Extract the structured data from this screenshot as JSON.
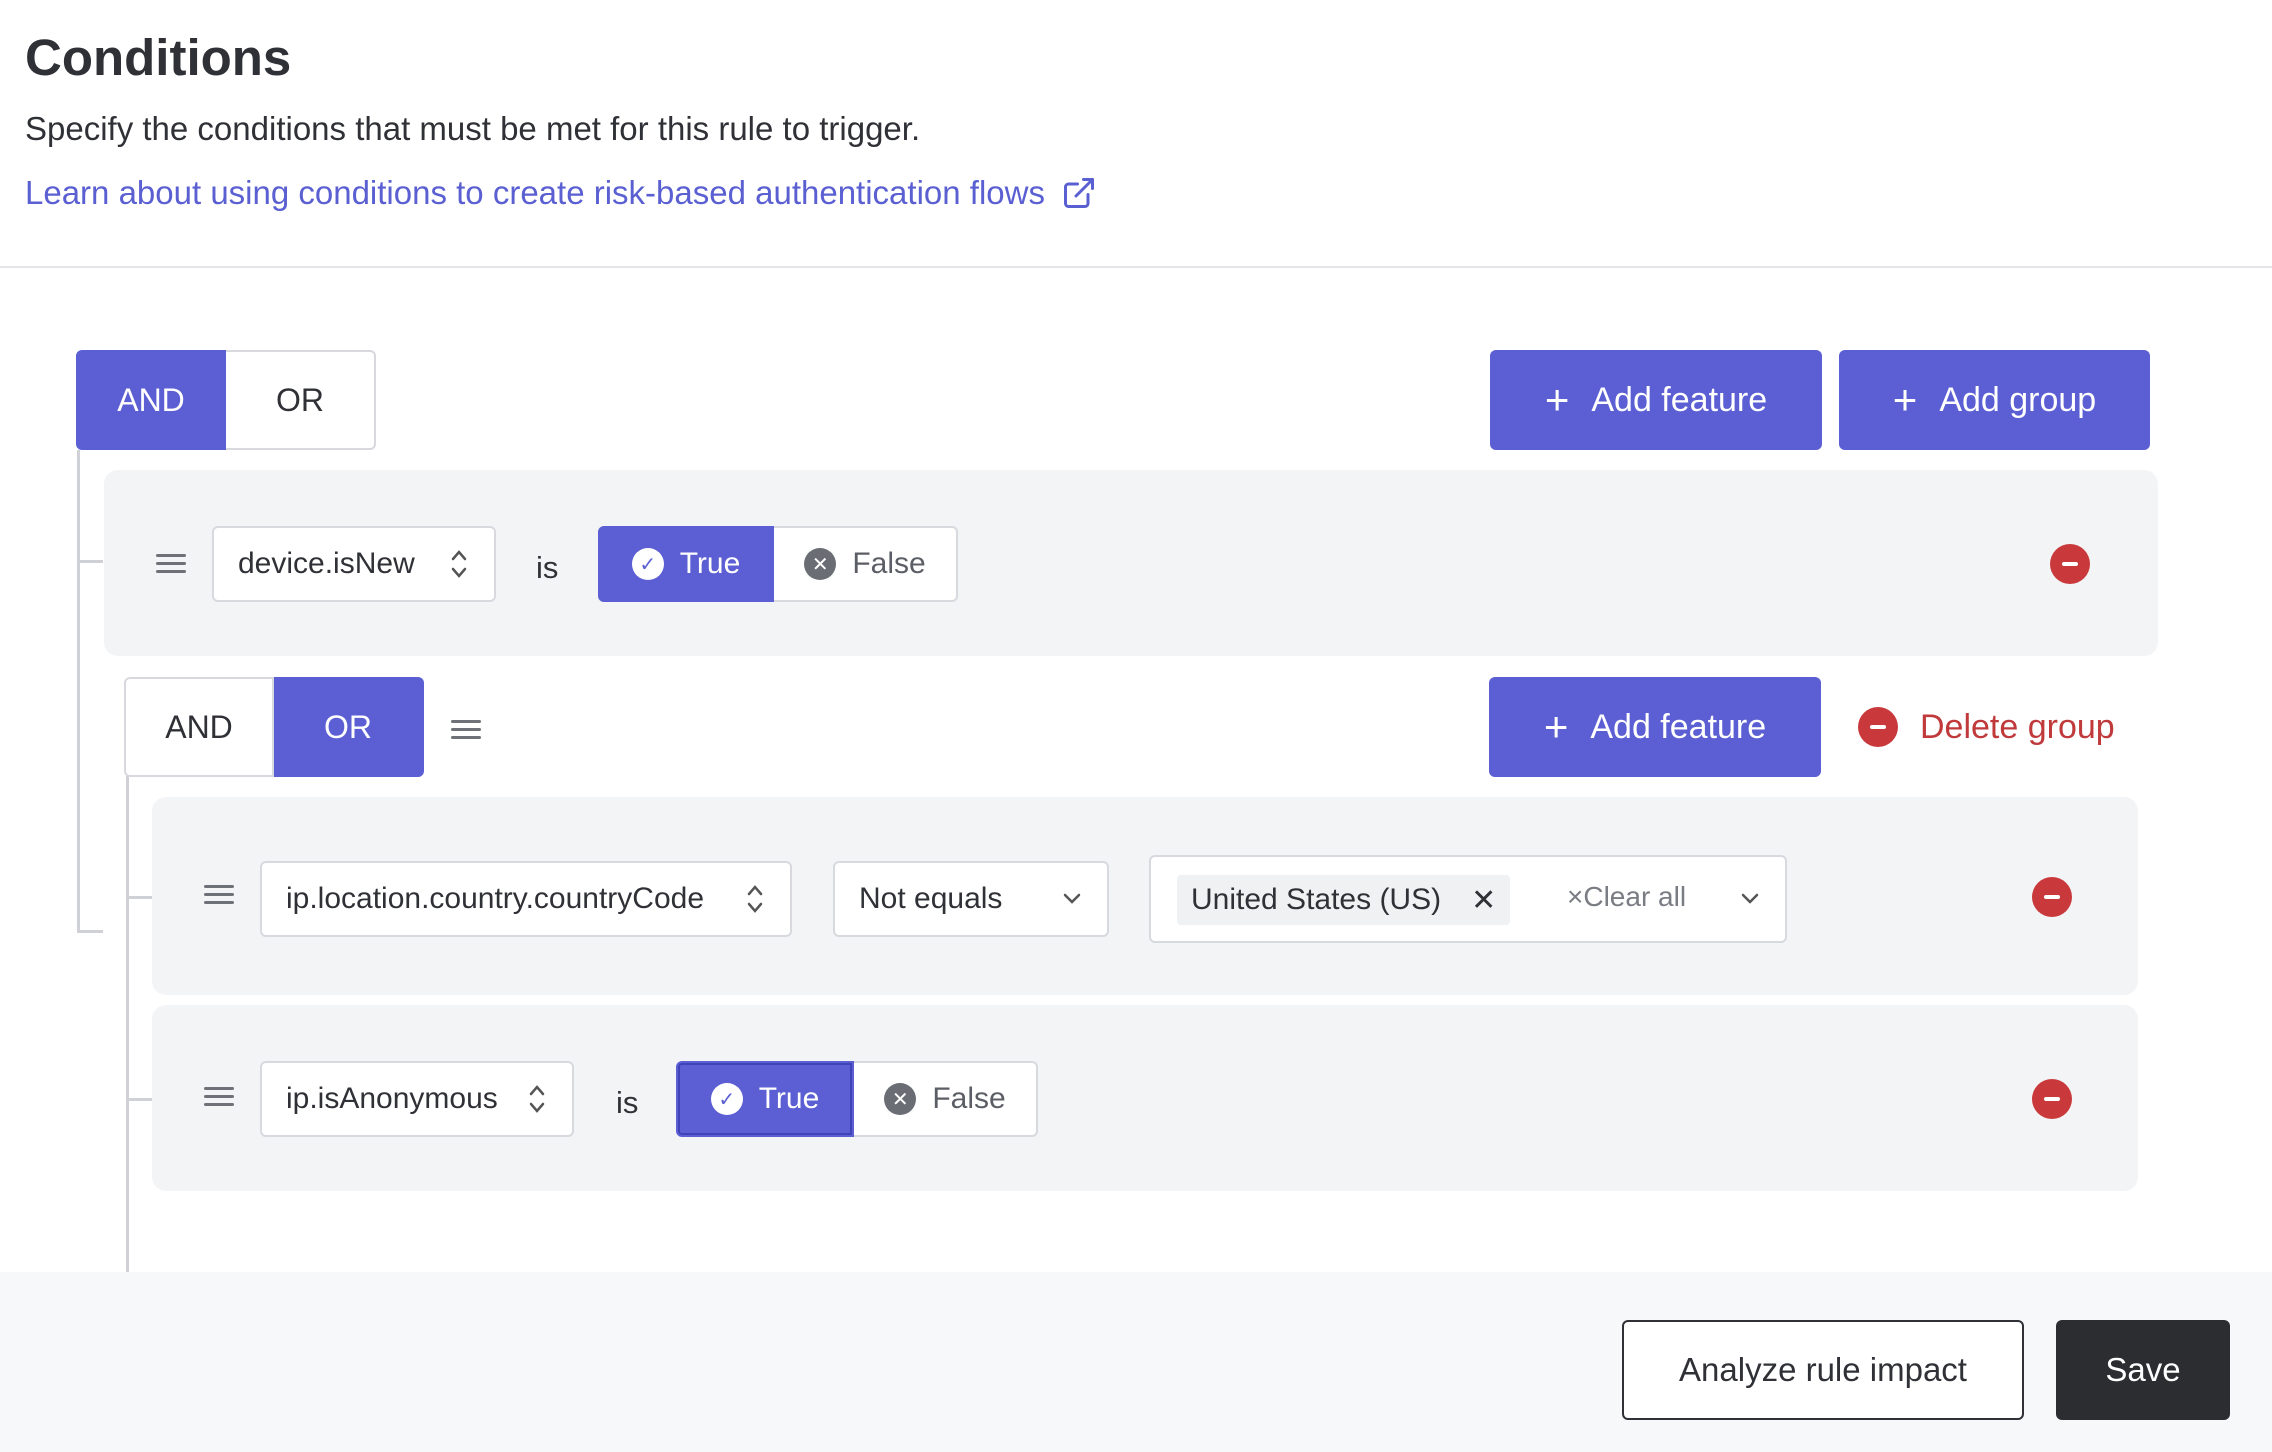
{
  "header": {
    "title": "Conditions",
    "subtitle": "Specify the conditions that must be met for this rule to trigger.",
    "learn_link": "Learn about using conditions to create risk-based authentication flows",
    "learn_link_icon": "external-link-icon"
  },
  "root_group": {
    "operator_options": [
      "AND",
      "OR"
    ],
    "operator_selected": "AND",
    "add_feature_label": "Add feature",
    "add_group_label": "Add group",
    "conditions": [
      {
        "feature": "device.isNew",
        "operator": "is",
        "value_options": [
          "True",
          "False"
        ],
        "value_selected": "True"
      }
    ]
  },
  "nested_group": {
    "operator_options": [
      "AND",
      "OR"
    ],
    "operator_selected": "OR",
    "add_feature_label": "Add feature",
    "delete_group_label": "Delete group",
    "conditions": [
      {
        "feature": "ip.location.country.countryCode",
        "operator": "Not equals",
        "selected_values": [
          "United States (US)"
        ],
        "clear_all_label": "Clear all"
      },
      {
        "feature": "ip.isAnonymous",
        "operator": "is",
        "value_options": [
          "True",
          "False"
        ],
        "value_selected": "True"
      }
    ]
  },
  "footer": {
    "analyze_label": "Analyze rule impact",
    "save_label": "Save"
  },
  "colors": {
    "primary": "#5b5fd3",
    "danger": "#c9393b",
    "link": "#5a5fd1",
    "dark_button": "#2b2d31"
  }
}
